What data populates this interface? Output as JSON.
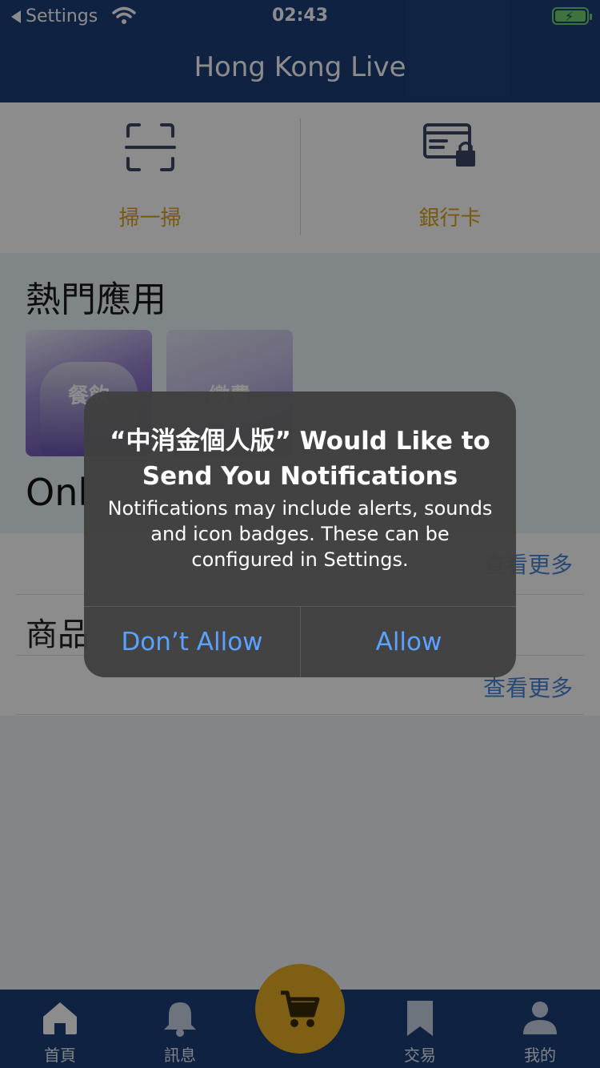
{
  "status_bar": {
    "back_label": "Settings",
    "time": "02:43"
  },
  "nav": {
    "title": "Hong Kong Live"
  },
  "quick_actions": [
    {
      "label": "掃一掃",
      "icon": "scan-icon"
    },
    {
      "label": "銀行卡",
      "icon": "bank-card-icon"
    }
  ],
  "hot_apps": {
    "title": "熱門應用",
    "tiles": [
      {
        "label": "餐飲"
      },
      {
        "label": "繳費"
      }
    ],
    "subheading": "Onl"
  },
  "lists": {
    "more_label_1": "查看更多",
    "goods_label": "商品",
    "more_label_2": "查看更多"
  },
  "tab_bar": {
    "items": [
      {
        "label": "首頁",
        "icon": "home-icon"
      },
      {
        "label": "訊息",
        "icon": "bell-icon"
      },
      {
        "label": "交易",
        "icon": "bookmark-icon"
      },
      {
        "label": "我的",
        "icon": "person-icon"
      }
    ],
    "center_icon": "cart-icon"
  },
  "alert": {
    "title": "“中消金個人版” Would Like to Send You Notifications",
    "message": "Notifications may include alerts, sounds and icon badges. These can be configured in Settings.",
    "deny_label": "Don’t Allow",
    "allow_label": "Allow"
  },
  "colors": {
    "primary": "#1e3f79",
    "accent": "#e6ad26",
    "link": "#4a86d8",
    "alert_button": "#5aa2ff"
  }
}
